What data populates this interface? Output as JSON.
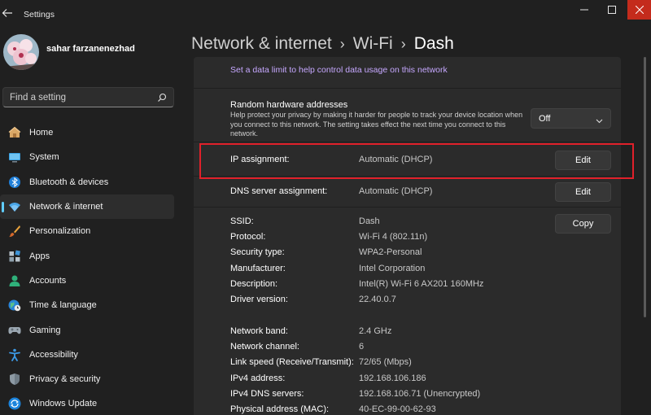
{
  "window": {
    "title": "Settings"
  },
  "user": {
    "name": "sahar farzanenezhad"
  },
  "search": {
    "placeholder": "Find a setting"
  },
  "nav": {
    "items": [
      {
        "label": "Home",
        "icon": "home-icon"
      },
      {
        "label": "System",
        "icon": "monitor-icon"
      },
      {
        "label": "Bluetooth & devices",
        "icon": "bluetooth-icon"
      },
      {
        "label": "Network & internet",
        "icon": "wifi-icon",
        "selected": true
      },
      {
        "label": "Personalization",
        "icon": "brush-icon"
      },
      {
        "label": "Apps",
        "icon": "apps-icon"
      },
      {
        "label": "Accounts",
        "icon": "person-icon"
      },
      {
        "label": "Time & language",
        "icon": "globe-clock-icon"
      },
      {
        "label": "Gaming",
        "icon": "gamepad-icon"
      },
      {
        "label": "Accessibility",
        "icon": "accessibility-icon"
      },
      {
        "label": "Privacy & security",
        "icon": "shield-icon"
      },
      {
        "label": "Windows Update",
        "icon": "sync-icon"
      }
    ]
  },
  "breadcrumb": {
    "level1": "Network & internet",
    "level2": "Wi-Fi",
    "current": "Dash",
    "separator": "›"
  },
  "data_limit": {
    "link": "Set a data limit to help control data usage on this network"
  },
  "random_hw": {
    "title": "Random hardware addresses",
    "description": "Help protect your privacy by making it harder for people to track your device location when you connect to this network. The setting takes effect the next time you connect to this network.",
    "value": "Off"
  },
  "ip_assignment": {
    "label": "IP assignment:",
    "value": "Automatic (DHCP)",
    "button": "Edit"
  },
  "dns_assignment": {
    "label": "DNS server assignment:",
    "value": "Automatic (DHCP)",
    "button": "Edit"
  },
  "copy_button": "Copy",
  "properties": [
    {
      "label": "SSID:",
      "value": "Dash"
    },
    {
      "label": "Protocol:",
      "value": "Wi-Fi 4 (802.11n)"
    },
    {
      "label": "Security type:",
      "value": "WPA2-Personal"
    },
    {
      "label": "Manufacturer:",
      "value": "Intel Corporation"
    },
    {
      "label": "Description:",
      "value": "Intel(R) Wi-Fi 6 AX201 160MHz"
    },
    {
      "label": "Driver version:",
      "value": "22.40.0.7"
    },
    {
      "label": "Network band:",
      "value": "2.4 GHz"
    },
    {
      "label": "Network channel:",
      "value": "6"
    },
    {
      "label": "Link speed (Receive/Transmit):",
      "value": "72/65 (Mbps)"
    },
    {
      "label": "IPv4 address:",
      "value": "192.168.106.186"
    },
    {
      "label": "IPv4 DNS servers:",
      "value": "192.168.106.71 (Unencrypted)"
    },
    {
      "label": "Physical address (MAC):",
      "value": "40-EC-99-00-62-93"
    }
  ],
  "colors": {
    "accent": "#60cdff",
    "highlight": "#e0202a",
    "link": "#c6a8ff"
  }
}
